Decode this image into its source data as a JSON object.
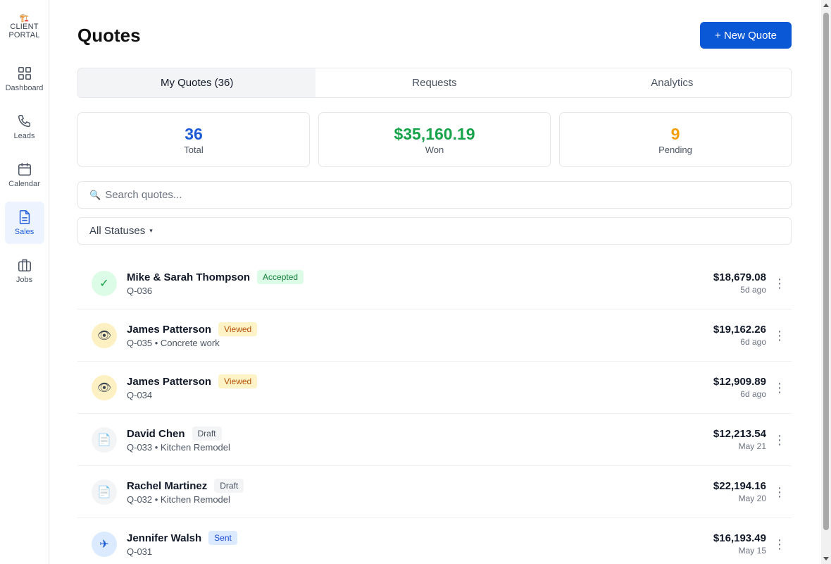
{
  "sidebar": {
    "logo_icon": "🏗️",
    "logo_line1": "CLIENT",
    "logo_line2": "PORTAL",
    "items": [
      {
        "label": "Dashboard",
        "icon": "grid-icon"
      },
      {
        "label": "Leads",
        "icon": "phone-icon"
      },
      {
        "label": "Calendar",
        "icon": "calendar-icon"
      },
      {
        "label": "Sales",
        "icon": "document-icon",
        "active": true
      },
      {
        "label": "Jobs",
        "icon": "briefcase-icon"
      }
    ]
  },
  "header": {
    "title": "Quotes",
    "new_quote_label": "+ New Quote"
  },
  "tabs": [
    {
      "label": "My Quotes (36)",
      "active": true
    },
    {
      "label": "Requests"
    },
    {
      "label": "Analytics"
    }
  ],
  "stats": [
    {
      "value": "36",
      "label": "Total",
      "color": "#1d5bd6"
    },
    {
      "value": "$35,160.19",
      "label": "Won",
      "color": "#16a34a"
    },
    {
      "value": "9",
      "label": "Pending",
      "color": "#f59e0b"
    }
  ],
  "search": {
    "icon": "🔍",
    "placeholder": "Search quotes..."
  },
  "filter": {
    "label": "All Statuses",
    "caret": "▾"
  },
  "quotes": [
    {
      "name": "Mike & Sarah Thompson",
      "status": "Accepted",
      "sub": "Q-036",
      "amount": "$18,679.08",
      "when": "5d ago",
      "icon": "✓"
    },
    {
      "name": "James Patterson",
      "status": "Viewed",
      "sub": "Q-035 • Concrete work",
      "amount": "$19,162.26",
      "when": "6d ago",
      "icon": "👁"
    },
    {
      "name": "James Patterson",
      "status": "Viewed",
      "sub": "Q-034",
      "amount": "$12,909.89",
      "when": "6d ago",
      "icon": "👁"
    },
    {
      "name": "David Chen",
      "status": "Draft",
      "sub": "Q-033 • Kitchen Remodel",
      "amount": "$12,213.54",
      "when": "May 21",
      "icon": "📄"
    },
    {
      "name": "Rachel Martinez",
      "status": "Draft",
      "sub": "Q-032 • Kitchen Remodel",
      "amount": "$22,194.16",
      "when": "May 20",
      "icon": "📄"
    },
    {
      "name": "Jennifer Walsh",
      "status": "Sent",
      "sub": "Q-031",
      "amount": "$16,193.49",
      "when": "May 15",
      "icon": "✈"
    }
  ],
  "status_styles": {
    "Accepted": {
      "circle_bg": "#dcfce7",
      "circle_fg": "#16a34a",
      "badge_bg": "#dcfce7",
      "badge_fg": "#15803d"
    },
    "Viewed": {
      "circle_bg": "#fdf0c2",
      "circle_fg": "#374151",
      "badge_bg": "#fef3c7",
      "badge_fg": "#b45309"
    },
    "Draft": {
      "circle_bg": "#f3f4f6",
      "circle_fg": "#6b7280",
      "badge_bg": "#f3f4f6",
      "badge_fg": "#4b5563"
    },
    "Sent": {
      "circle_bg": "#dbeafe",
      "circle_fg": "#1d5bd6",
      "badge_bg": "#dbeafe",
      "badge_fg": "#1d4ed8"
    }
  },
  "kebab": "⋮"
}
